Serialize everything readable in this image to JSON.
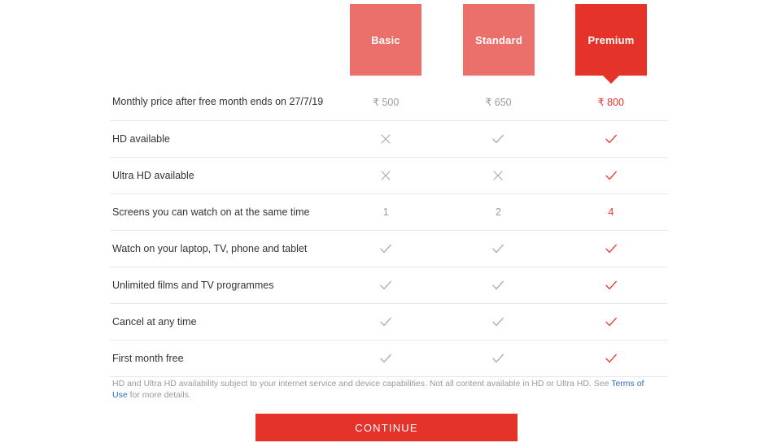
{
  "plans": [
    {
      "id": "basic",
      "label": "Basic",
      "color": "#eb6f6a",
      "selected": false
    },
    {
      "id": "standard",
      "label": "Standard",
      "color": "#eb6f6a",
      "selected": false
    },
    {
      "id": "premium",
      "label": "Premium",
      "color": "#e6332a",
      "selected": true
    }
  ],
  "table": {
    "rows": [
      {
        "feature": "Monthly price after free month ends on 27/7/19",
        "values": [
          {
            "type": "text",
            "text": "₹ 500"
          },
          {
            "type": "text",
            "text": "₹ 650"
          },
          {
            "type": "text",
            "text": "₹ 800"
          }
        ]
      },
      {
        "feature": "HD available",
        "values": [
          {
            "type": "cross",
            "icon": "cross-icon"
          },
          {
            "type": "check",
            "icon": "check-icon"
          },
          {
            "type": "check",
            "icon": "check-icon"
          }
        ]
      },
      {
        "feature": "Ultra HD available",
        "values": [
          {
            "type": "cross",
            "icon": "cross-icon"
          },
          {
            "type": "cross",
            "icon": "cross-icon"
          },
          {
            "type": "check",
            "icon": "check-icon"
          }
        ]
      },
      {
        "feature": "Screens you can watch on at the same time",
        "values": [
          {
            "type": "text",
            "text": "1"
          },
          {
            "type": "text",
            "text": "2"
          },
          {
            "type": "text",
            "text": "4"
          }
        ]
      },
      {
        "feature": "Watch on your laptop, TV, phone and tablet",
        "values": [
          {
            "type": "check",
            "icon": "check-icon"
          },
          {
            "type": "check",
            "icon": "check-icon"
          },
          {
            "type": "check",
            "icon": "check-icon"
          }
        ]
      },
      {
        "feature": "Unlimited films and TV programmes",
        "values": [
          {
            "type": "check",
            "icon": "check-icon"
          },
          {
            "type": "check",
            "icon": "check-icon"
          },
          {
            "type": "check",
            "icon": "check-icon"
          }
        ]
      },
      {
        "feature": "Cancel at any time",
        "values": [
          {
            "type": "check",
            "icon": "check-icon"
          },
          {
            "type": "check",
            "icon": "check-icon"
          },
          {
            "type": "check",
            "icon": "check-icon"
          }
        ]
      },
      {
        "feature": "First month free",
        "values": [
          {
            "type": "check",
            "icon": "check-icon"
          },
          {
            "type": "check",
            "icon": "check-icon"
          },
          {
            "type": "check",
            "icon": "check-icon"
          }
        ]
      }
    ]
  },
  "footnote": {
    "before_link": "HD and Ultra HD availability subject to your internet service and device capabilities. Not all content available in HD or Ultra HD. See ",
    "link_text": "Terms of Use",
    "after_link": " for more details."
  },
  "continue_button": {
    "label": "CONTINUE"
  },
  "colors": {
    "accent_red": "#e6332a",
    "plan_muted_red": "#eb6f6a",
    "grey_text": "#9a9a9a",
    "dark_text": "#333333",
    "link_blue": "#2d6fc4",
    "divider": "#e6e6e6"
  }
}
